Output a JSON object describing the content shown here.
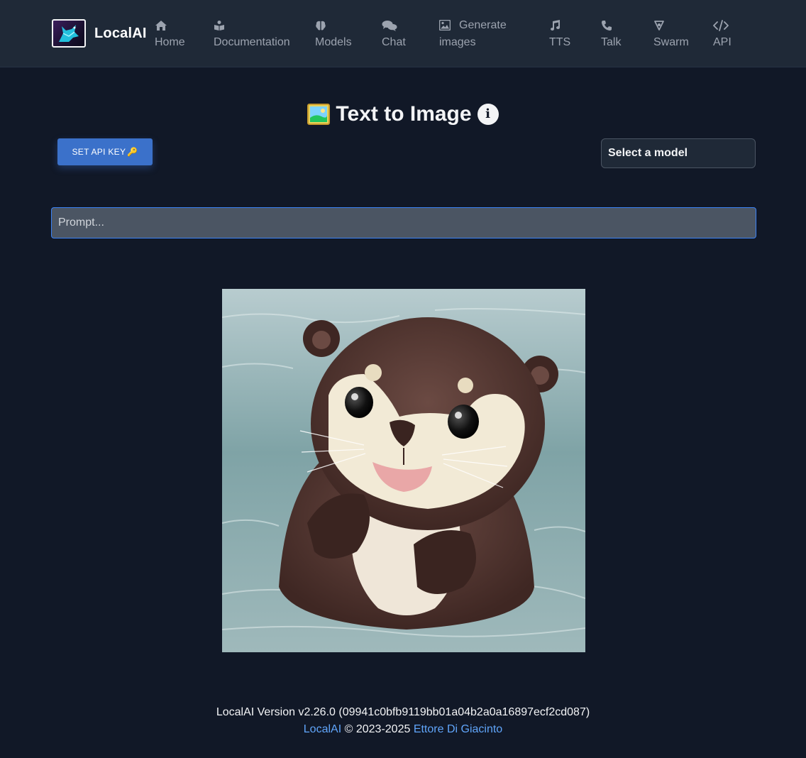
{
  "brand": {
    "name": "LocalAI",
    "logo_icon": "localai-logo-icon"
  },
  "nav": {
    "items": [
      {
        "label": "Home",
        "icon": "home-icon"
      },
      {
        "label": "Documentation",
        "icon": "docs-icon"
      },
      {
        "label": "Models",
        "icon": "brain-icon"
      },
      {
        "label": "Chat",
        "icon": "chat-icon"
      },
      {
        "label_line1": "Generate",
        "label_line2": "images",
        "icon": "image-icon"
      },
      {
        "label": "TTS",
        "icon": "music-icon"
      },
      {
        "label": "Talk",
        "icon": "phone-icon"
      },
      {
        "label": "Swarm",
        "icon": "network-icon"
      },
      {
        "label": "API",
        "icon": "code-icon"
      }
    ]
  },
  "page": {
    "title": "Text to Image",
    "title_emoji": "framed-picture-emoji",
    "info_icon": "info-icon"
  },
  "controls": {
    "api_key_label": "SET API KEY",
    "api_key_glyph": "🔑",
    "model_select_label": "Select a model",
    "prompt_placeholder": "Prompt..."
  },
  "result": {
    "image_subject": "otter-image"
  },
  "footer": {
    "version_text": "LocalAI Version v2.26.0 (09941c0bfb9119bb01a04b2a0a16897ecf2cd087)",
    "link_localai": "LocalAI",
    "copyright": "© 2023-2025",
    "link_author": "Ettore Di Giacinto"
  },
  "colors": {
    "background": "#111827",
    "navbar": "#1f2937",
    "accent_button": "#3b71ca",
    "link": "#60a5fa",
    "input_border_focus": "#3b82f6"
  }
}
